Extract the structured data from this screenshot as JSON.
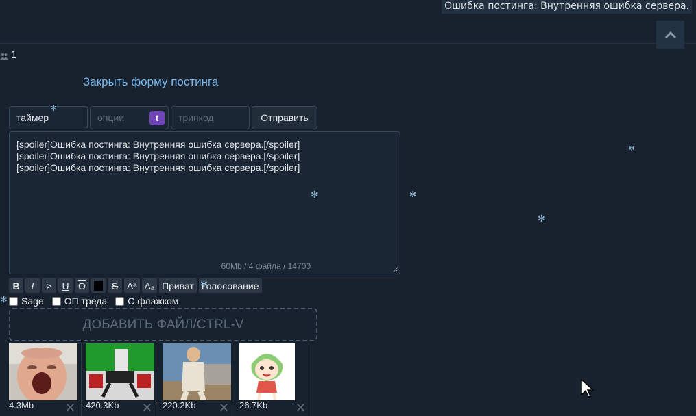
{
  "notification": {
    "text": "Ошибка постинга: Внутренняя ошибка сервера."
  },
  "online": {
    "count": "1",
    "icon": "users-icon"
  },
  "form": {
    "close_label": "Закрыть форму постинга",
    "name_value": "таймер",
    "options_placeholder": "опции",
    "options_badge": "t",
    "trip_placeholder": "трипкод",
    "submit_label": "Отправить",
    "comment_lines": [
      "[spoiler]Ошибка постинга: Внутренняя ошибка сервера.[/spoiler]",
      "[spoiler]Ошибка постинга: Внутренняя ошибка сервера.[/spoiler]",
      "[spoiler]Ошибка постинга: Внутренняя ошибка сервера.[/spoiler]"
    ],
    "counter": "60Mb / 4 файла / 14700",
    "markup_buttons": [
      "B",
      "I",
      ">",
      "U",
      "O",
      "",
      "S",
      "Aª",
      "Aₐ",
      "Приват",
      "Голосование"
    ],
    "checkboxes": [
      "Sage",
      "ОП треда",
      "С флажком"
    ],
    "add_file_label": "ДОБАВИТЬ ФАЙЛ/CTRL-V",
    "files": [
      {
        "size": "4.3Mb"
      },
      {
        "size": "420.3Kb"
      },
      {
        "size": "220.2Kb"
      },
      {
        "size": "26.7Kb"
      }
    ]
  },
  "colors": {
    "background": "#18222e",
    "accent_link": "#74b6ee",
    "badge": "#6f45b8"
  }
}
